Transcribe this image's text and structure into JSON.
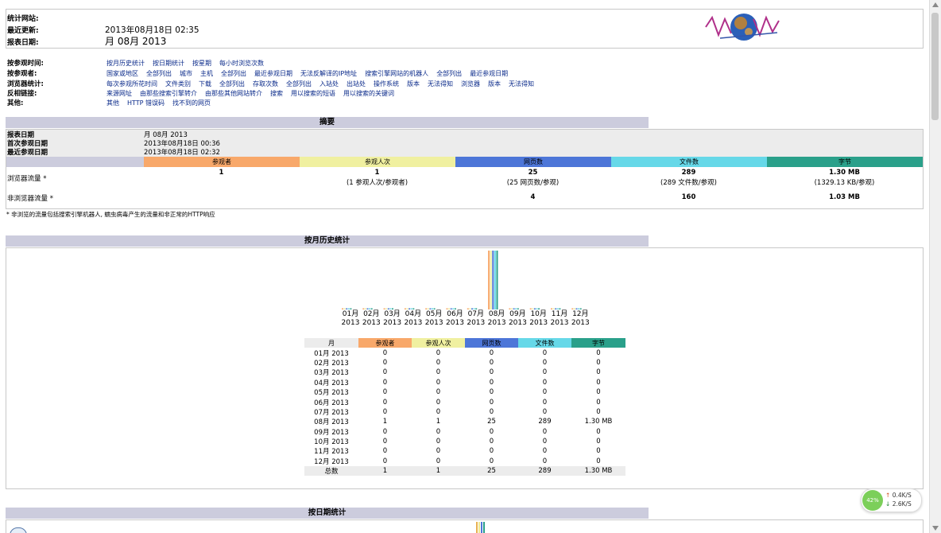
{
  "header": {
    "site_label": "统计网站:",
    "updated_label": "最近更新:",
    "updated_value": "2013年08月18日 02:35",
    "period_label": "报表日期:",
    "period_value": "月 08月 2013"
  },
  "nav": [
    {
      "label": "按参观时间:",
      "links": [
        "按月历史统计",
        "按日期统计",
        "按星期",
        "每小时浏览次数"
      ]
    },
    {
      "label": "按参观者:",
      "links": [
        "国家或地区",
        "全部列出",
        "城市",
        "主机",
        "全部列出",
        "最近参观日期",
        "无法反解译的IP地址",
        "搜索引擎网站的机器人",
        "全部列出",
        "最近参观日期"
      ]
    },
    {
      "label": "浏览器统计:",
      "links": [
        "每次参观所花时间",
        "文件类别",
        "下载",
        "全部列出",
        "存取次数",
        "全部列出",
        "入站处",
        "出站处",
        "操作系统",
        "版本",
        "无法得知",
        "浏览器",
        "版本",
        "无法得知"
      ]
    },
    {
      "label": "反相链接:",
      "links": [
        "来源网址",
        "由那些搜索引擎转介",
        "由那些其他网站转介",
        "搜索",
        "用以搜索的短语",
        "用以搜索的关键词"
      ]
    },
    {
      "label": "其他:",
      "links": [
        "其他",
        "HTTP 错误码",
        "找不到的网页"
      ]
    }
  ],
  "summary": {
    "title": "摘要",
    "period_label": "报表日期",
    "period_value": "月 08月 2013",
    "first_label": "首次参观日期",
    "first_value": "2013年08月18日 00:36",
    "last_label": "最近参观日期",
    "last_value": "2013年08月18日 02:32",
    "columns": [
      "参观者",
      "参观人次",
      "网页数",
      "文件数",
      "字节"
    ],
    "column_colors": [
      "#f8a86a",
      "#f0f0a0",
      "#4d76d8",
      "#66d8e8",
      "#2aa08a"
    ],
    "browser_label": "浏览器流量 *",
    "browser_values": [
      "1",
      "1",
      "25",
      "289",
      "1.30 MB"
    ],
    "browser_sub": [
      "",
      "(1 参观人次/参观者)",
      "(25 网页数/参观)",
      "(289 文件数/参观)",
      "(1329.13 KB/参观)"
    ],
    "nonbrowser_label": "非浏览器流量 *",
    "nonbrowser_values": [
      "",
      "",
      "4",
      "160",
      "1.03 MB"
    ],
    "footnote": "* 非浏览的流量包括搜索引擎机器人, 蠕虫病毒产生的流量和非正常的HTTP响应"
  },
  "monthly": {
    "title": "按月历史统计",
    "headers": [
      "月",
      "参观者",
      "参观人次",
      "网页数",
      "文件数",
      "字节"
    ],
    "rows": [
      [
        "01月 2013",
        "0",
        "0",
        "0",
        "0",
        "0"
      ],
      [
        "02月 2013",
        "0",
        "0",
        "0",
        "0",
        "0"
      ],
      [
        "03月 2013",
        "0",
        "0",
        "0",
        "0",
        "0"
      ],
      [
        "04月 2013",
        "0",
        "0",
        "0",
        "0",
        "0"
      ],
      [
        "05月 2013",
        "0",
        "0",
        "0",
        "0",
        "0"
      ],
      [
        "06月 2013",
        "0",
        "0",
        "0",
        "0",
        "0"
      ],
      [
        "07月 2013",
        "0",
        "0",
        "0",
        "0",
        "0"
      ],
      [
        "08月 2013",
        "1",
        "1",
        "25",
        "289",
        "1.30 MB"
      ],
      [
        "09月 2013",
        "0",
        "0",
        "0",
        "0",
        "0"
      ],
      [
        "10月 2013",
        "0",
        "0",
        "0",
        "0",
        "0"
      ],
      [
        "11月 2013",
        "0",
        "0",
        "0",
        "0",
        "0"
      ],
      [
        "12月 2013",
        "0",
        "0",
        "0",
        "0",
        "0"
      ]
    ],
    "total": [
      "总数",
      "1",
      "1",
      "25",
      "289",
      "1.30 MB"
    ],
    "axis_months": [
      "01月",
      "02月",
      "03月",
      "04月",
      "05月",
      "06月",
      "07月",
      "08月",
      "09月",
      "10月",
      "11月",
      "12月"
    ],
    "axis_year": "2013"
  },
  "chart_data": {
    "type": "bar",
    "categories": [
      "01月 2013",
      "02月 2013",
      "03月 2013",
      "04月 2013",
      "05月 2013",
      "06月 2013",
      "07月 2013",
      "08月 2013",
      "09月 2013",
      "10月 2013",
      "11月 2013",
      "12月 2013"
    ],
    "series": [
      {
        "name": "参观者",
        "color": "#f8a86a",
        "values": [
          0,
          0,
          0,
          0,
          0,
          0,
          0,
          1,
          0,
          0,
          0,
          0
        ]
      },
      {
        "name": "参观人次",
        "color": "#f0f0a0",
        "values": [
          0,
          0,
          0,
          0,
          0,
          0,
          0,
          1,
          0,
          0,
          0,
          0
        ]
      },
      {
        "name": "网页数",
        "color": "#4d76d8",
        "values": [
          0,
          0,
          0,
          0,
          0,
          0,
          0,
          25,
          0,
          0,
          0,
          0
        ]
      },
      {
        "name": "文件数",
        "color": "#66d8e8",
        "values": [
          0,
          0,
          0,
          0,
          0,
          0,
          0,
          289,
          0,
          0,
          0,
          0
        ]
      },
      {
        "name": "字节",
        "color": "#2aa08a",
        "values": [
          0,
          0,
          0,
          0,
          0,
          0,
          0,
          1.3,
          0,
          0,
          0,
          0
        ]
      }
    ]
  },
  "daily": {
    "title": "按日期统计"
  },
  "net_widget": {
    "percent": "42%",
    "up": "0.4K/S",
    "down": "2.6K/S",
    "up_arrow": "↑",
    "down_arrow": "↓"
  }
}
